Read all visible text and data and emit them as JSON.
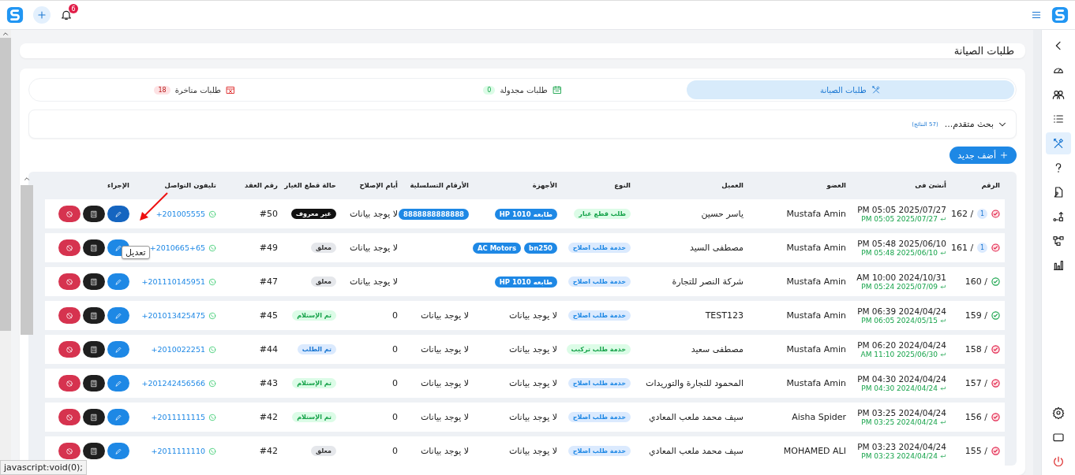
{
  "top_bar": {
    "notification_count": "6"
  },
  "sidebar": {
    "items": [
      {
        "kind": "back",
        "selected": false
      },
      {
        "kind": "gauge",
        "selected": false
      },
      {
        "kind": "users",
        "selected": false
      },
      {
        "kind": "list",
        "selected": false
      },
      {
        "kind": "tools",
        "selected": true
      },
      {
        "kind": "question",
        "selected": false
      },
      {
        "kind": "document",
        "selected": false
      },
      {
        "kind": "route",
        "selected": false
      },
      {
        "kind": "hierarchy",
        "selected": false
      },
      {
        "kind": "chart",
        "selected": false
      }
    ],
    "bottom_items": [
      {
        "kind": "settings"
      },
      {
        "kind": "window"
      },
      {
        "kind": "power"
      }
    ]
  },
  "page_title": "طلبات الصيانة",
  "tabs": [
    {
      "label": "طلبات الصيانة",
      "kind": "tools",
      "selected": true
    },
    {
      "label": "طلبات مجدولة",
      "kind": "calendar",
      "count": "0",
      "selected": false
    },
    {
      "label": "طلبات متاخرة",
      "kind": "calendar-x",
      "count": "18",
      "selected": false
    }
  ],
  "search": {
    "label": "بحث متقدم...",
    "results": "(57 النتائج)",
    "expanded": false
  },
  "add_button": "أضف جديد",
  "table": {
    "columns": [
      "الرقم",
      "أنشئ فى",
      "العضو",
      "العميل",
      "النوع",
      "الأجهزة",
      "الأرقام التسلسلية",
      "أيام الإصلاح",
      "حالة قطع الغيار",
      "رقم العقد",
      "تليفون التواصل",
      "الإجراء"
    ],
    "rows": [
      {
        "done": false,
        "badge": "1",
        "number": "162 /",
        "created": "PM 05:05 2025/07/27",
        "updated": "PM 05:05 2025/07/27",
        "member": "Mustafa Amin",
        "client": "ياسر حسين",
        "type": {
          "label": "طلب قطع غيار",
          "kind": "green"
        },
        "devices": [
          "طابعه HP 1010"
        ],
        "serials": [
          "8888888888888"
        ],
        "repair_days": "لا يوجد بيانات",
        "parts": {
          "label": "غير معروف",
          "kind": "unknown"
        },
        "contract": "#50",
        "phone": "+201005555",
        "edit_hovered": true
      },
      {
        "done": false,
        "badge": "1",
        "number": "161 /",
        "created": "PM 05:48 2025/06/10",
        "updated": "PM 05:48 2025/06/10",
        "member": "Mustafa Amin",
        "client": "مصطفى السيد",
        "type": {
          "label": "خدمة طلب اصلاح",
          "kind": "blue"
        },
        "devices": [
          "bn250",
          "AC Motors"
        ],
        "repair_days": "لا يوجد بيانات",
        "parts": {
          "label": "معلق",
          "kind": "pending"
        },
        "contract": "#49",
        "phone": "+2010665+65",
        "edit_hovered": false
      },
      {
        "done": true,
        "number": "160 /",
        "created": "AM 10:00 2024/10/31",
        "updated": "PM 05:24 2025/07/09",
        "member": "Mustafa Amin",
        "client": "شركة النصر للتجارة",
        "type": {
          "label": "خدمة طلب اصلاح",
          "kind": "blue"
        },
        "devices": [
          "طابعه HP 1010"
        ],
        "repair_days": "لا يوجد بيانات",
        "parts": {
          "label": "معلق",
          "kind": "pending"
        },
        "contract": "#47",
        "phone": "+201110145951",
        "edit_hovered": false
      },
      {
        "done": true,
        "number": "159 /",
        "created": "PM 06:39 2024/04/24",
        "updated": "PM 06:05 2024/05/15",
        "member": "Mustafa Amin",
        "client": "TEST123",
        "type": {
          "label": "خدمة طلب اصلاح",
          "kind": "blue"
        },
        "devices_text": "لا يوجد بيانات",
        "serials_text": "لا يوجد بيانات",
        "repair_days": "0",
        "parts": {
          "label": "تم الإستلام",
          "kind": "received"
        },
        "contract": "#45",
        "phone": "+201013425475",
        "edit_hovered": false
      },
      {
        "done": false,
        "number": "158 /",
        "created": "PM 06:20 2024/04/24",
        "updated": "AM 11:10 2025/06/30",
        "member": "Mustafa Amin",
        "client": "مصطفى سعيد",
        "type": {
          "label": "خدمة طلب تركيب",
          "kind": "green"
        },
        "devices_text": "لا يوجد بيانات",
        "serials_text": "لا يوجد بيانات",
        "repair_days": "0",
        "parts": {
          "label": "تم الطلب",
          "kind": "ordered"
        },
        "contract": "#44",
        "phone": "+2010022251",
        "edit_hovered": false
      },
      {
        "done": false,
        "number": "157 /",
        "created": "PM 04:30 2024/04/24",
        "updated": "PM 04:30 2024/04/24",
        "member": "Mustafa Amin",
        "client": "المحمود للتجارة والتوريدات",
        "type": {
          "label": "خدمة طلب اصلاح",
          "kind": "blue"
        },
        "devices_text": "لا يوجد بيانات",
        "serials_text": "لا يوجد بيانات",
        "repair_days": "0",
        "parts": {
          "label": "تم الإستلام",
          "kind": "received"
        },
        "contract": "#43",
        "phone": "+201242456566",
        "edit_hovered": false
      },
      {
        "done": false,
        "number": "156 /",
        "created": "PM 03:25 2024/04/24",
        "updated": "PM 03:25 2024/04/24",
        "member": "Aisha Spider",
        "client": "سيف محمد ملعب المعادي",
        "type": {
          "label": "خدمة طلب اصلاح",
          "kind": "blue"
        },
        "devices_text": "لا يوجد بيانات",
        "serials_text": "لا يوجد بيانات",
        "repair_days": "0",
        "parts": {
          "label": "تم الإستلام",
          "kind": "received"
        },
        "contract": "#42",
        "phone": "+2011111115",
        "edit_hovered": false
      },
      {
        "done": false,
        "number": "155 /",
        "created": "PM 03:23 2024/04/24",
        "updated": "PM 03:23 2024/04/24",
        "member": "MOHAMED ALI",
        "client": "سيف محمد ملعب المعادي",
        "type": {
          "label": "خدمة طلب اصلاح",
          "kind": "blue"
        },
        "devices_text": "لا يوجد بيانات",
        "serials_text": "لا يوجد بيانات",
        "repair_days": "0",
        "parts": {
          "label": "معلق",
          "kind": "pending"
        },
        "contract": "#42",
        "phone": "+2011111110",
        "edit_hovered": false
      }
    ]
  },
  "tooltip": "تعديل",
  "status_link": "javascript:void(0);"
}
